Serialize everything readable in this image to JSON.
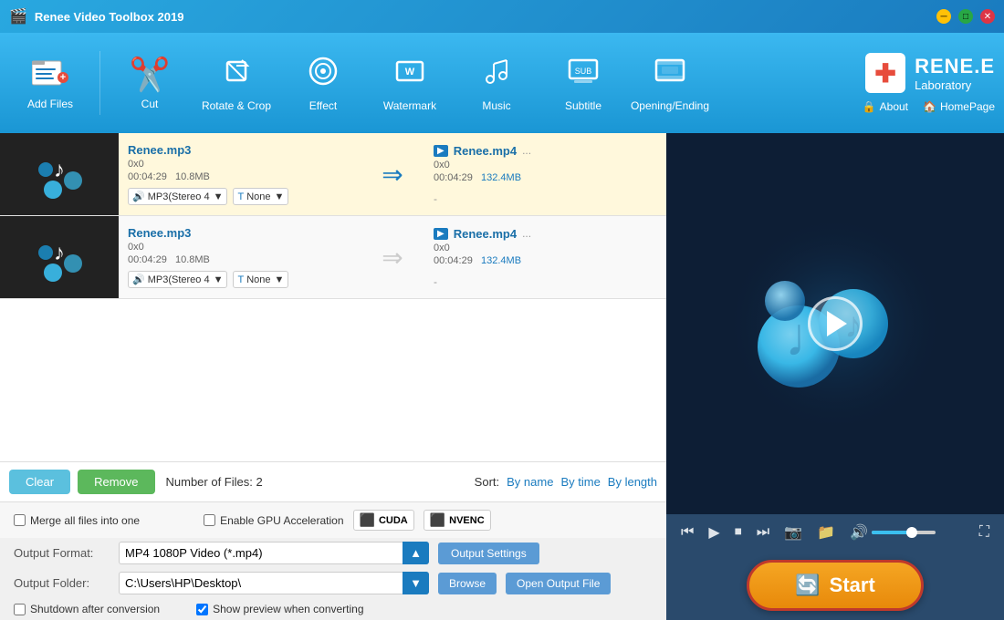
{
  "app": {
    "title": "Renee Video Toolbox 2019",
    "brand_name": "RENE.E",
    "brand_sub": "Laboratory"
  },
  "toolbar": {
    "items": [
      {
        "id": "add-files",
        "label": "Add Files",
        "icon": "🎬"
      },
      {
        "id": "cut",
        "label": "Cut",
        "icon": "✂️"
      },
      {
        "id": "rotate-crop",
        "label": "Rotate & Crop",
        "icon": "🔄"
      },
      {
        "id": "effect",
        "label": "Effect",
        "icon": "✨"
      },
      {
        "id": "watermark",
        "label": "Watermark",
        "icon": "🎭"
      },
      {
        "id": "music",
        "label": "Music",
        "icon": "🎵"
      },
      {
        "id": "subtitle",
        "label": "Subtitle",
        "icon": "💬"
      },
      {
        "id": "opening-ending",
        "label": "Opening/Ending",
        "icon": "📺"
      }
    ],
    "about_label": "About",
    "homepage_label": "HomePage"
  },
  "files": [
    {
      "id": "file-1",
      "input_name": "Renee.mp3",
      "input_dims": "0x0",
      "input_duration": "00:04:29",
      "input_size": "10.8MB",
      "output_name": "Renee.mp4",
      "output_dims": "0x0",
      "output_duration": "00:04:29",
      "output_size": "132.4MB",
      "audio_track": "MP3(Stereo 4",
      "subtitle": "None",
      "selected": true
    },
    {
      "id": "file-2",
      "input_name": "Renee.mp3",
      "input_dims": "0x0",
      "input_duration": "00:04:29",
      "input_size": "10.8MB",
      "output_name": "Renee.mp4",
      "output_dims": "0x0",
      "output_duration": "00:04:29",
      "output_size": "132.4MB",
      "audio_track": "MP3(Stereo 4",
      "subtitle": "None",
      "selected": false
    }
  ],
  "action_bar": {
    "clear_label": "Clear",
    "remove_label": "Remove",
    "file_count_label": "Number of Files:",
    "file_count": "2",
    "sort_label": "Sort:",
    "sort_by_name": "By name",
    "sort_by_time": "By time",
    "sort_by_length": "By length"
  },
  "settings": {
    "merge_label": "Merge all files into one",
    "gpu_label": "Enable GPU Acceleration",
    "cuda_label": "CUDA",
    "nvenc_label": "NVENC"
  },
  "output": {
    "format_label": "Output Format:",
    "format_value": "MP4 1080P Video (*.mp4)",
    "settings_label": "Output Settings",
    "folder_label": "Output Folder:",
    "folder_value": "C:\\Users\\HP\\Desktop\\",
    "browse_label": "Browse",
    "open_label": "Open Output File",
    "shutdown_label": "Shutdown after conversion",
    "preview_label": "Show preview when converting"
  },
  "player": {
    "start_label": "Start",
    "controls": {
      "prev": "⏮",
      "play": "▶",
      "stop": "⏹",
      "next": "⏭",
      "screenshot": "📷",
      "folder": "📁",
      "volume": "🔊",
      "fullscreen": "⛶"
    }
  }
}
